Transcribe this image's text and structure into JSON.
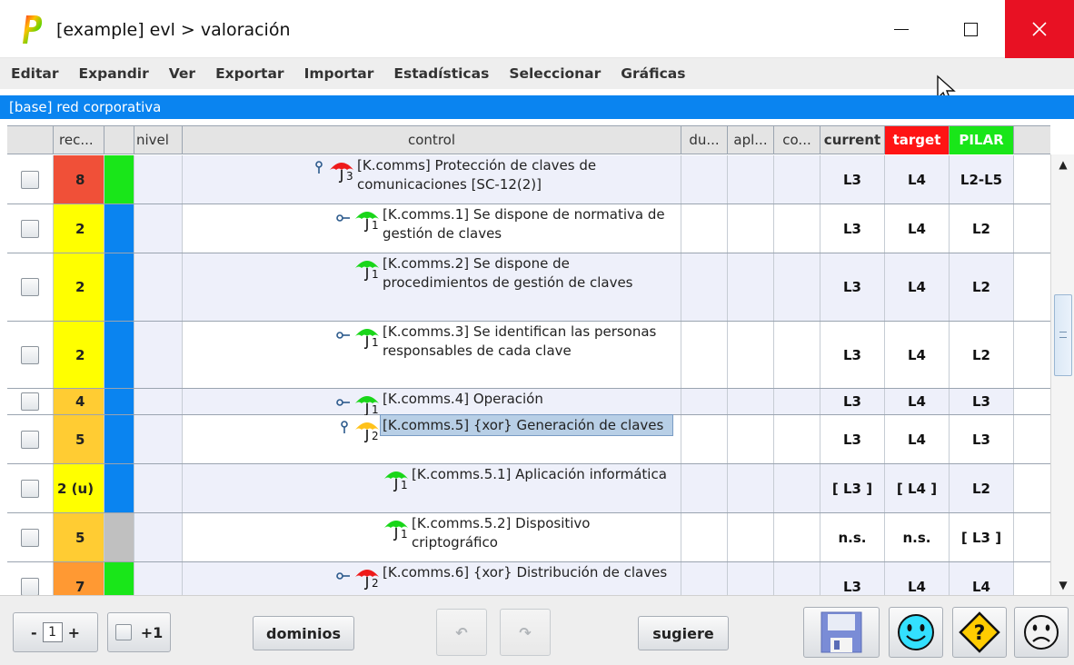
{
  "window": {
    "title": "[example] evl > valoración"
  },
  "menu": [
    "Editar",
    "Expandir",
    "Ver",
    "Exportar",
    "Importar",
    "Estadísticas",
    "Seleccionar",
    "Gráficas"
  ],
  "path": "[base] red corporativa",
  "columns": {
    "select": "",
    "rec": "rec...",
    "status": "",
    "nivel": "nivel",
    "control": "control",
    "du": "du...",
    "apl": "apl...",
    "co": "co...",
    "current": "current",
    "target": "target",
    "pilar": "PILAR"
  },
  "colors": {
    "accent": "#0a84f0",
    "red": "#f05038",
    "yellow": "#ffff00",
    "orange": "#ffcc33",
    "green": "#19e619",
    "blue": "#0a84f0",
    "gray": "#c0c0c0",
    "selection": "#b8cfe6"
  },
  "rows": [
    {
      "rec": "8",
      "rec_color": "#f05038",
      "status_color": "#19e619",
      "indent": 0,
      "expander": "collapsed-open",
      "umbrella": "red",
      "level": "3",
      "text": "[K.comms] Protección de claves de comunicaciones [SC-12(2)]",
      "current": "L3",
      "target": "L4",
      "pilar": "L2-L5",
      "height": 54,
      "alt": true,
      "selected": false
    },
    {
      "rec": "2",
      "rec_color": "#ffff00",
      "status_color": "#0a84f0",
      "indent": 1,
      "expander": "key",
      "umbrella": "green",
      "level": "1",
      "text": "[K.comms.1] Se dispone de normativa de gestión de claves",
      "current": "L3",
      "target": "L4",
      "pilar": "L2",
      "height": 54,
      "alt": false,
      "selected": false
    },
    {
      "rec": "2",
      "rec_color": "#ffff00",
      "status_color": "#0a84f0",
      "indent": 1,
      "expander": "none",
      "umbrella": "green",
      "level": "1",
      "text": "[K.comms.2] Se dispone de procedimientos de gestión de claves",
      "current": "L3",
      "target": "L4",
      "pilar": "L2",
      "height": 75,
      "alt": true,
      "selected": false
    },
    {
      "rec": "2",
      "rec_color": "#ffff00",
      "status_color": "#0a84f0",
      "indent": 1,
      "expander": "key",
      "umbrella": "green",
      "level": "1",
      "text": "[K.comms.3] Se identifican las personas responsables de cada clave",
      "current": "L3",
      "target": "L4",
      "pilar": "L2",
      "height": 74,
      "alt": false,
      "selected": false
    },
    {
      "rec": "4",
      "rec_color": "#ffcc33",
      "status_color": "#0a84f0",
      "indent": 1,
      "expander": "key",
      "umbrella": "green",
      "level": "1",
      "text": "[K.comms.4] Operación",
      "current": "L3",
      "target": "L4",
      "pilar": "L3",
      "height": 29,
      "alt": true,
      "selected": false
    },
    {
      "rec": "5",
      "rec_color": "#ffcc33",
      "status_color": "#0a84f0",
      "indent": 1,
      "expander": "collapsed-open",
      "umbrella": "yellow",
      "level": "2",
      "text": "[K.comms.5] {xor} Generación de claves",
      "current": "L3",
      "target": "L4",
      "pilar": "L3",
      "height": 54,
      "alt": false,
      "selected": true
    },
    {
      "rec": "2 (u)",
      "rec_color": "#ffff00",
      "status_color": "#0a84f0",
      "indent": 2,
      "expander": "none",
      "umbrella": "green",
      "level": "1",
      "text": "[K.comms.5.1] Aplicación informática",
      "current": "[ L3 ]",
      "target": "[ L4 ]",
      "pilar": "L2",
      "height": 54,
      "alt": true,
      "selected": false
    },
    {
      "rec": "5",
      "rec_color": "#ffcc33",
      "status_color": "#c0c0c0",
      "indent": 2,
      "expander": "none",
      "umbrella": "green",
      "level": "1",
      "text": "[K.comms.5.2] Dispositivo criptográfico",
      "current": "n.s.",
      "target": "n.s.",
      "pilar": "[ L3 ]",
      "height": 54,
      "alt": false,
      "selected": false
    },
    {
      "rec": "7",
      "rec_color": "#ff9933",
      "status_color": "#19e619",
      "indent": 1,
      "expander": "key",
      "umbrella": "red",
      "level": "2",
      "text": "[K.comms.6] {xor} Distribución de claves",
      "current": "L3",
      "target": "L4",
      "pilar": "L4",
      "height": 54,
      "alt": true,
      "selected": false
    }
  ],
  "bottom": {
    "spinner_minus": "-",
    "spinner_value": "1",
    "spinner_plus": "+",
    "plus_one": "+1",
    "dominios": "dominios",
    "undo": "↶",
    "redo": "↷",
    "sugiere": "sugiere"
  }
}
